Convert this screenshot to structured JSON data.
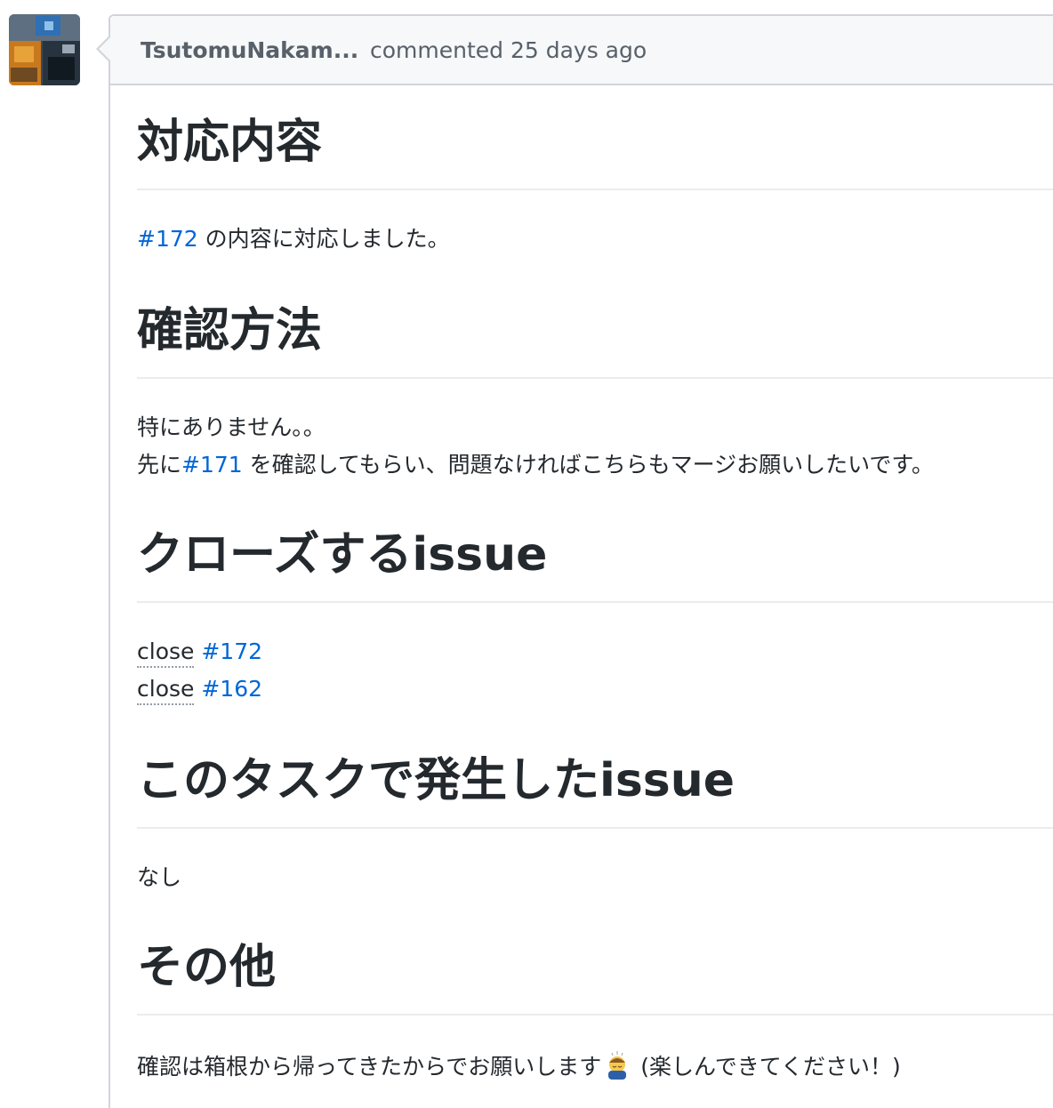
{
  "comment": {
    "author": "TsutomuNakam...",
    "meta": "commented 25 days ago"
  },
  "sections": [
    {
      "heading": "対応内容",
      "link": "#172",
      "text": " の内容に対応しました。"
    },
    {
      "heading": "確認方法",
      "line1": "特にありません。。",
      "line2_prefix": "先に",
      "line2_link": "#171",
      "line2_suffix": " を確認してもらい、問題なければこちらもマージお願いしたいです。"
    },
    {
      "heading": "クローズするissue",
      "items": [
        {
          "keyword": "close",
          "link": "#172"
        },
        {
          "keyword": "close",
          "link": "#162"
        }
      ]
    },
    {
      "heading": "このタスクで発生したissue",
      "text": "なし"
    },
    {
      "heading": "その他",
      "text_before": "確認は箱根から帰ってきたからでお願いします",
      "emoji": "bowing-person-emoji",
      "text_after": " (楽しんできてください！)"
    }
  ],
  "colors": {
    "link": "#0366d6",
    "text": "#24292e",
    "muted": "#586069",
    "border": "#d1d5da",
    "header_bg": "#f6f8fa"
  }
}
